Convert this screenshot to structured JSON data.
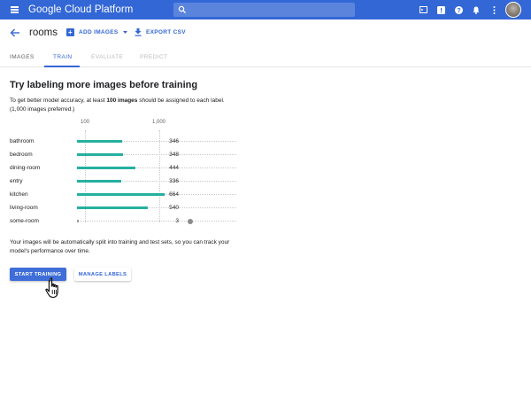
{
  "header": {
    "brand": "Google Cloud Platform",
    "icons": [
      "menu-icon",
      "search-icon",
      "console-icon",
      "notification-icon",
      "help-icon",
      "alert-icon",
      "more-vert-icon",
      "user-avatar"
    ]
  },
  "toolbar": {
    "title": "rooms",
    "add_images_label": "ADD IMAGES",
    "export_label": "EXPORT CSV"
  },
  "tabs": [
    {
      "label": "IMAGES",
      "state": "normal"
    },
    {
      "label": "TRAIN",
      "state": "active"
    },
    {
      "label": "EVALUATE",
      "state": "disabled"
    },
    {
      "label": "PREDICT",
      "state": "disabled"
    }
  ],
  "main": {
    "heading": "Try labeling more images before training",
    "desc_pre": "To get better model accuracy, at least ",
    "desc_bold": "100 images",
    "desc_post": " should be assigned to each label. (1,000 images preferred.)",
    "scale_low": "100",
    "scale_high": "1,000",
    "note": "Your images will be automatically split into training and test sets, so you can track your model's performance over time.",
    "start_label": "START TRAINING",
    "manage_label": "MANAGE LABELS"
  },
  "labels": [
    {
      "name": "bathroom",
      "count": "346",
      "value": 346
    },
    {
      "name": "bedroom",
      "count": "348",
      "value": 348
    },
    {
      "name": "dining-room",
      "count": "444",
      "value": 444
    },
    {
      "name": "entry",
      "count": "336",
      "value": 336
    },
    {
      "name": "kitchen",
      "count": "664",
      "value": 664
    },
    {
      "name": "living-room",
      "count": "540",
      "value": 540
    },
    {
      "name": "some-room",
      "count": "3",
      "value": 3,
      "warning": true
    }
  ],
  "colors": {
    "primary": "#3367d6",
    "bar": "#26b0a0",
    "warning": "#8b8b8b"
  }
}
